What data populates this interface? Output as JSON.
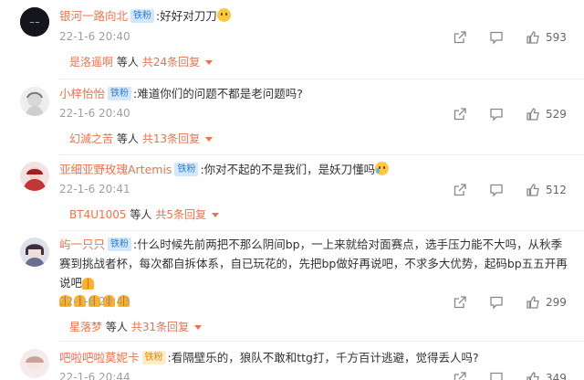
{
  "comments": [
    {
      "username": "银河一路向北",
      "badge": "铁粉",
      "text": "好好对刀刀",
      "emoji": "sweat-smile-emoji",
      "time": "22-1-6 20:40",
      "likes": "593",
      "reply": {
        "first_name": "是洛遥啊",
        "middle": "等人",
        "total": "共24条回复"
      }
    },
    {
      "username": "小梓怡怡",
      "badge": "铁粉",
      "text": "难道你们的问题不都是老问题吗?",
      "time": "22-1-6 20:40",
      "likes": "529",
      "reply": {
        "first_name": "幻滅之苦",
        "middle": "等人",
        "total": "共13条回复"
      }
    },
    {
      "username": "亚细亚野玫瑰Artemis",
      "badge": "铁粉",
      "text": "你对不起的不是我们，是妖刀懂吗",
      "emoji": "crying-emoji",
      "time": "22-1-6 20:41",
      "likes": "512",
      "reply": {
        "first_name": "BT4U1005",
        "middle": "等人",
        "total": "共5条回复"
      }
    },
    {
      "username": "屿一只只",
      "badge": "铁粉",
      "text": "什么时候先前两把不那么阴间bp，一上来就给对面赛点，选手压力能不大吗，从秋季赛到挑战者杯，每次都自拆体系，自已玩花的，先把bp做好再说吧，不求多大优势，起码bp五五开再说吧",
      "time": "22-1-6 20:43",
      "likes": "299",
      "reply": {
        "first_name": "星落梦",
        "middle": "等人",
        "total": "共31条回复"
      }
    },
    {
      "username": "吧啦吧啦莫妮卡",
      "badge": "铁粉",
      "text": "看隔壁乐的，狼队不敢和ttg打，千方百计逃避，觉得丢人吗?",
      "time": "22-1-6 20:44",
      "likes": "349"
    }
  ],
  "icons": {
    "share": "share-icon",
    "comment": "comment-icon",
    "like": "like-icon"
  }
}
